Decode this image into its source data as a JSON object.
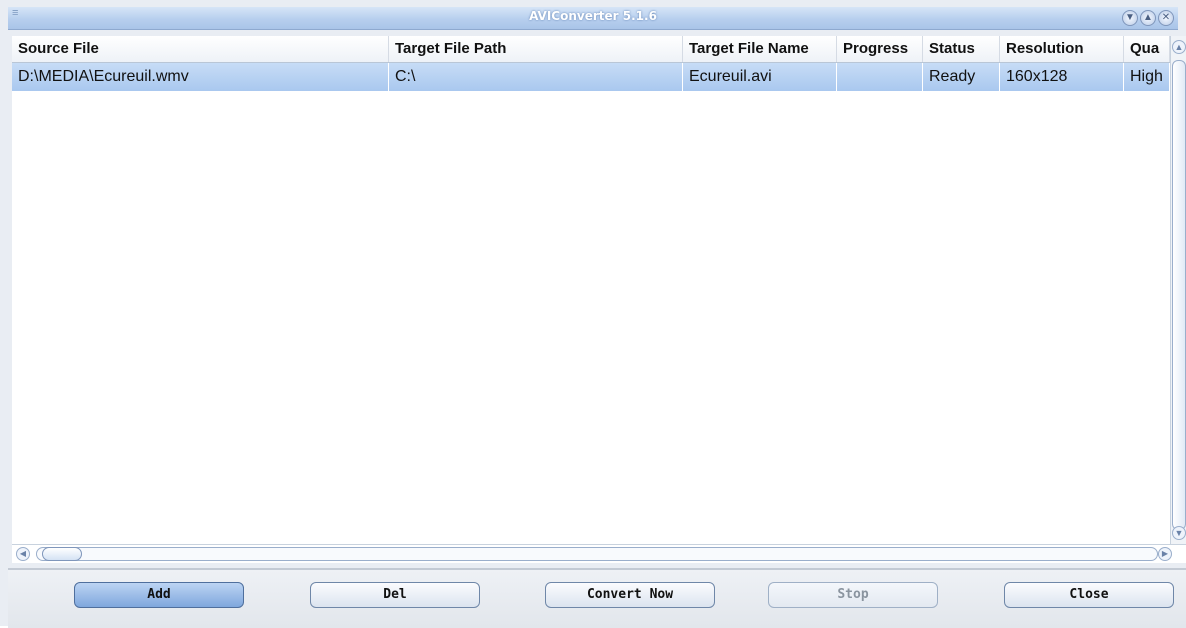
{
  "window": {
    "title": "AVIConverter 5.1.6"
  },
  "table": {
    "columns": [
      "Source File",
      "Target File Path",
      "Target File Name",
      "Progress",
      "Status",
      "Resolution",
      "Qua"
    ],
    "rows": [
      {
        "source": "D:\\MEDIA\\Ecureuil.wmv",
        "path": "C:\\",
        "name": "Ecureuil.avi",
        "progress": "",
        "status": "Ready",
        "resolution": "160x128",
        "quality": "High"
      }
    ]
  },
  "buttons": {
    "add": "Add",
    "del": "Del",
    "convert": "Convert Now",
    "stop": "Stop",
    "close": "Close"
  },
  "icons": {
    "minimize": "▼",
    "maximize": "▲",
    "close": "✕",
    "grip": "≡",
    "left": "◀",
    "right": "▶",
    "up": "▲",
    "down": "▼"
  }
}
